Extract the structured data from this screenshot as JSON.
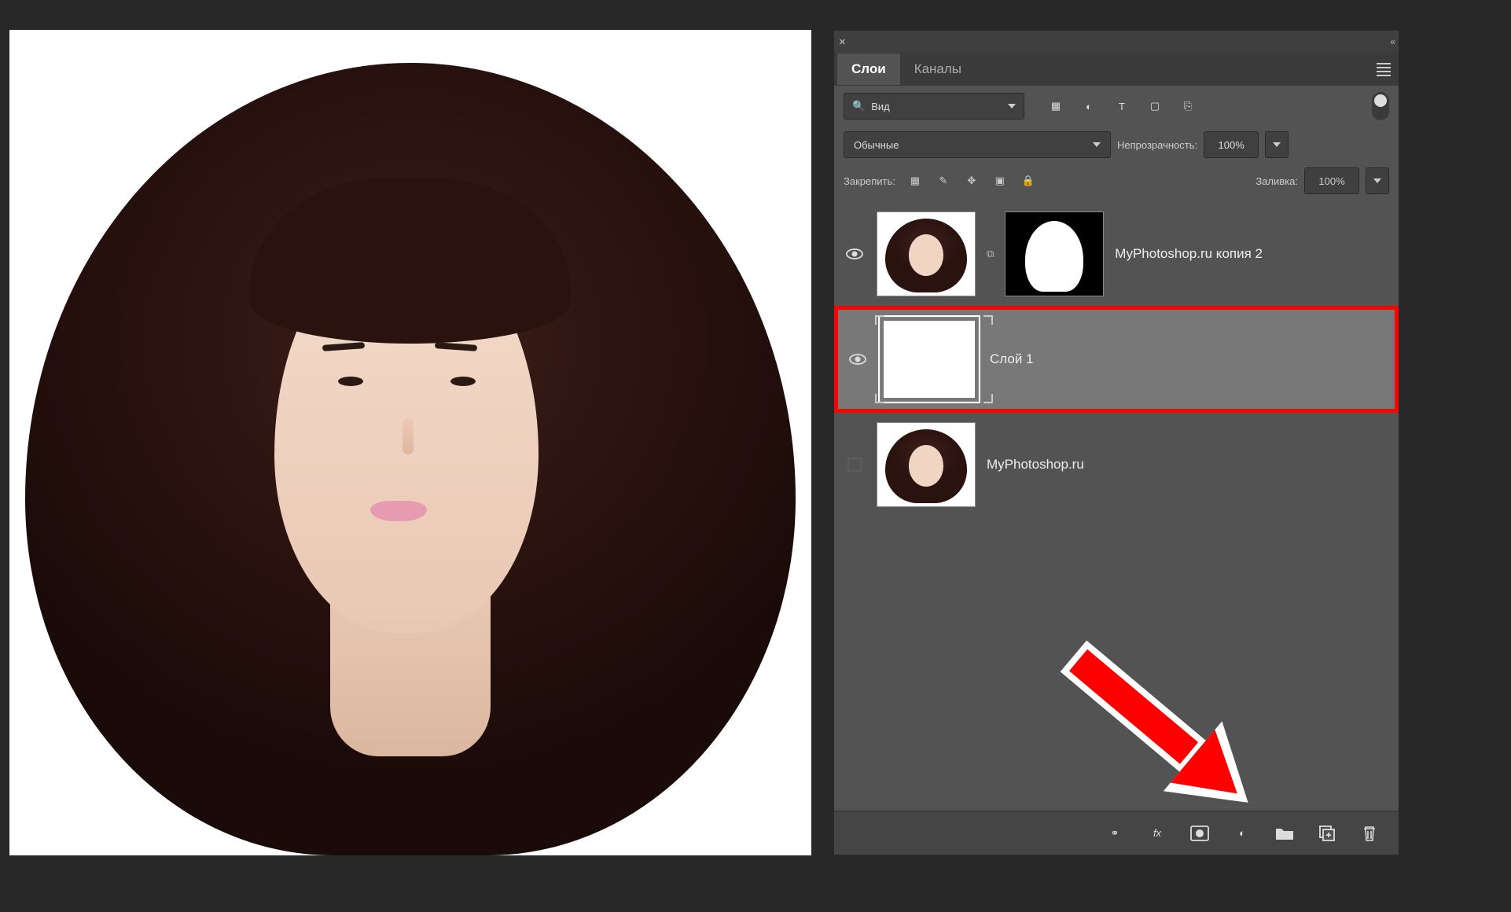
{
  "canvas": {
    "desc": "portrait photo"
  },
  "panel": {
    "close": "×",
    "collapse": "«",
    "tabs": {
      "layers": "Слои",
      "channels": "Каналы"
    },
    "menu": "≡",
    "search": {
      "icon": "🔍",
      "label": "Вид"
    },
    "filters": {
      "pixel": "▦",
      "adjust": "◐",
      "text": "T",
      "shape": "▢",
      "smart": "⎘"
    },
    "blend": {
      "mode": "Обычные",
      "opacity_label": "Непрозрачность:",
      "opacity_value": "100%"
    },
    "lock": {
      "label": "Закрепить:",
      "grid": "▦",
      "brush": "✎",
      "move": "✥",
      "crop": "▣",
      "lock": "🔒",
      "fill_label": "Заливка:",
      "fill_value": "100%"
    },
    "layers": [
      {
        "visible": true,
        "name": "MyPhotoshop.ru копия 2",
        "mask": true
      },
      {
        "visible": true,
        "name": "Слой 1",
        "selected": true,
        "blank": true
      },
      {
        "visible": false,
        "name": "MyPhotoshop.ru"
      }
    ],
    "footer": {
      "link": "⚭",
      "fx": "fx",
      "mask": "◻",
      "adjust": "◐",
      "group": "🗀",
      "new": "⊞",
      "trash": "🗑"
    }
  }
}
